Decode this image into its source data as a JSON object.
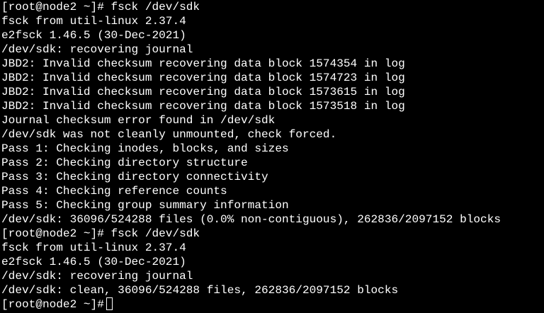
{
  "terminal": {
    "lines": [
      "[root@node2 ~]# fsck /dev/sdk",
      "fsck from util-linux 2.37.4",
      "e2fsck 1.46.5 (30-Dec-2021)",
      "/dev/sdk: recovering journal",
      "JBD2: Invalid checksum recovering data block 1574354 in log",
      "JBD2: Invalid checksum recovering data block 1574723 in log",
      "JBD2: Invalid checksum recovering data block 1573615 in log",
      "JBD2: Invalid checksum recovering data block 1573518 in log",
      "Journal checksum error found in /dev/sdk",
      "/dev/sdk was not cleanly unmounted, check forced.",
      "Pass 1: Checking inodes, blocks, and sizes",
      "Pass 2: Checking directory structure",
      "Pass 3: Checking directory connectivity",
      "Pass 4: Checking reference counts",
      "Pass 5: Checking group summary information",
      "/dev/sdk: 36096/524288 files (0.0% non-contiguous), 262836/2097152 blocks",
      "[root@node2 ~]# fsck /dev/sdk",
      "fsck from util-linux 2.37.4",
      "e2fsck 1.46.5 (30-Dec-2021)",
      "/dev/sdk: recovering journal",
      "/dev/sdk: clean, 36096/524288 files, 262836/2097152 blocks"
    ],
    "prompt": "[root@node2 ~]#"
  },
  "colors": {
    "background": "#000000",
    "text": "#ffffff"
  }
}
